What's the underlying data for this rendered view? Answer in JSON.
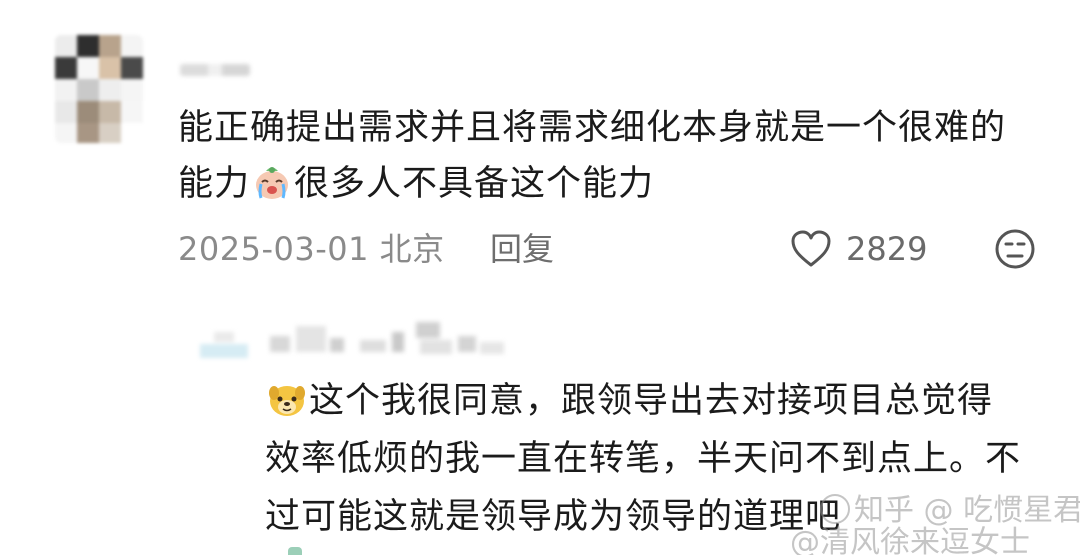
{
  "main_comment": {
    "text_part1": "能正确提出需求并且将需求细化本身就是一个很难的能力",
    "emoji_name": "crying-face-emoji",
    "text_part2": "很多人不具备这个能力",
    "date": "2025-03-01",
    "location": "北京",
    "reply_label": "回复",
    "like_count": "2829"
  },
  "reply_comment": {
    "emoji_name": "smiling-dog-emoji",
    "text": "这个我很同意，跟领导出去对接项目总觉得效率低烦的我一直在转笔，半天问不到点上。不过可能这就是领导成为领导的道理吧"
  },
  "watermark": {
    "line1": "知乎 @ 吃惯星君",
    "line2": "@清风徐来逗女士"
  }
}
